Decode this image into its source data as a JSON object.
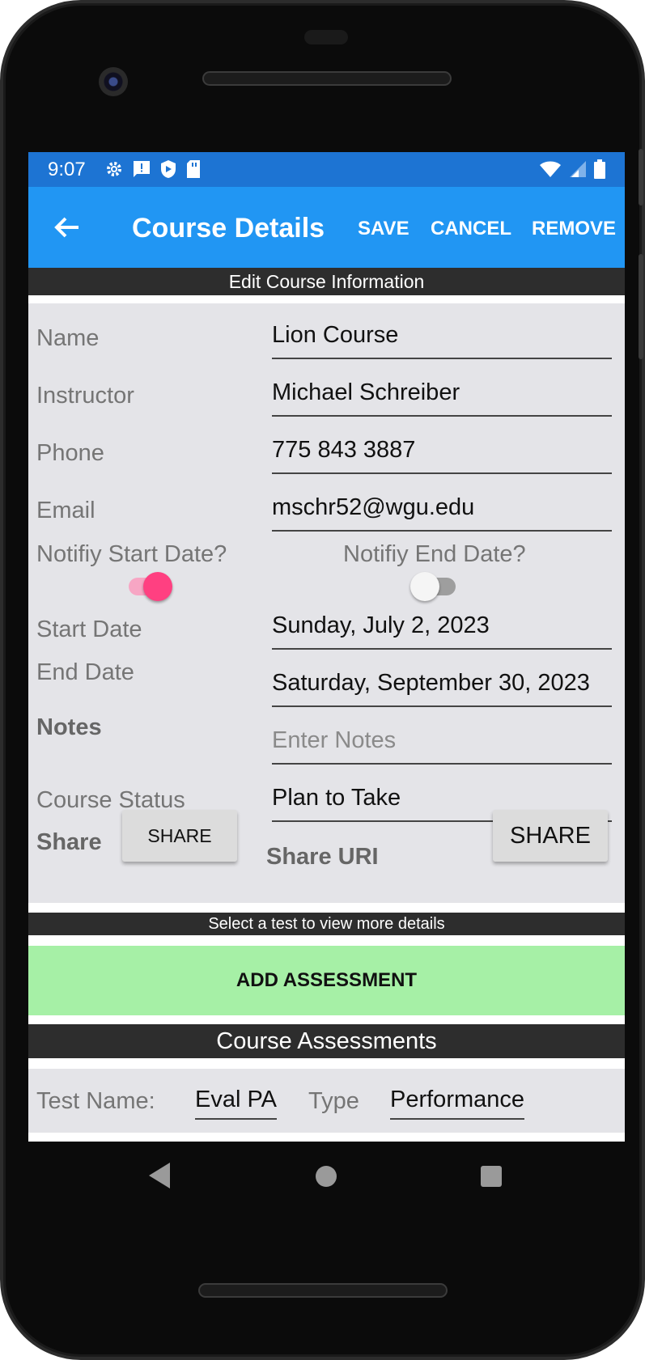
{
  "status": {
    "time": "9:07",
    "left_icons": [
      "settings-icon",
      "alert-message-icon",
      "shield-icon",
      "sd-card-icon"
    ],
    "right_icons": [
      "wifi-icon",
      "signal-icon",
      "battery-icon"
    ]
  },
  "appbar": {
    "title": "Course Details",
    "save": "SAVE",
    "cancel": "CANCEL",
    "remove": "REMOVE",
    "color": "#2196f3"
  },
  "section_header": "Edit Course Information",
  "form": {
    "name_label": "Name",
    "name_value": "Lion Course",
    "instructor_label": "Instructor",
    "instructor_value": "Michael Schreiber",
    "phone_label": "Phone",
    "phone_value": "775 843 3887",
    "email_label": "Email",
    "email_value": "mschr52@wgu.edu",
    "notify_start_label": "Notifiy Start Date?",
    "notify_start_on": true,
    "notify_end_label": "Notifiy End Date?",
    "notify_end_on": false,
    "start_label": "Start Date",
    "start_value": "Sunday, July 2, 2023",
    "end_label": "End Date",
    "end_value": "Saturday, September 30, 2023",
    "notes_label": "Notes",
    "notes_placeholder": "Enter Notes",
    "status_label": "Course Status",
    "status_value": "Plan to Take",
    "share_label": "Share",
    "share_button": "SHARE",
    "share_uri_label": "Share URI",
    "share_uri_button": "SHARE"
  },
  "tests_hint": "Select a test to view more details",
  "add_assessment": "ADD ASSESSMENT",
  "assessments_header": "Course Assessments",
  "assessment": {
    "test_name_label": "Test Name:",
    "test_name_value": "Eval PA",
    "type_label": "Type",
    "type_value": "Performance"
  },
  "colors": {
    "accent": "#ff4081",
    "add_button": "#a6f0a6",
    "statusbar": "#1d74d3"
  }
}
